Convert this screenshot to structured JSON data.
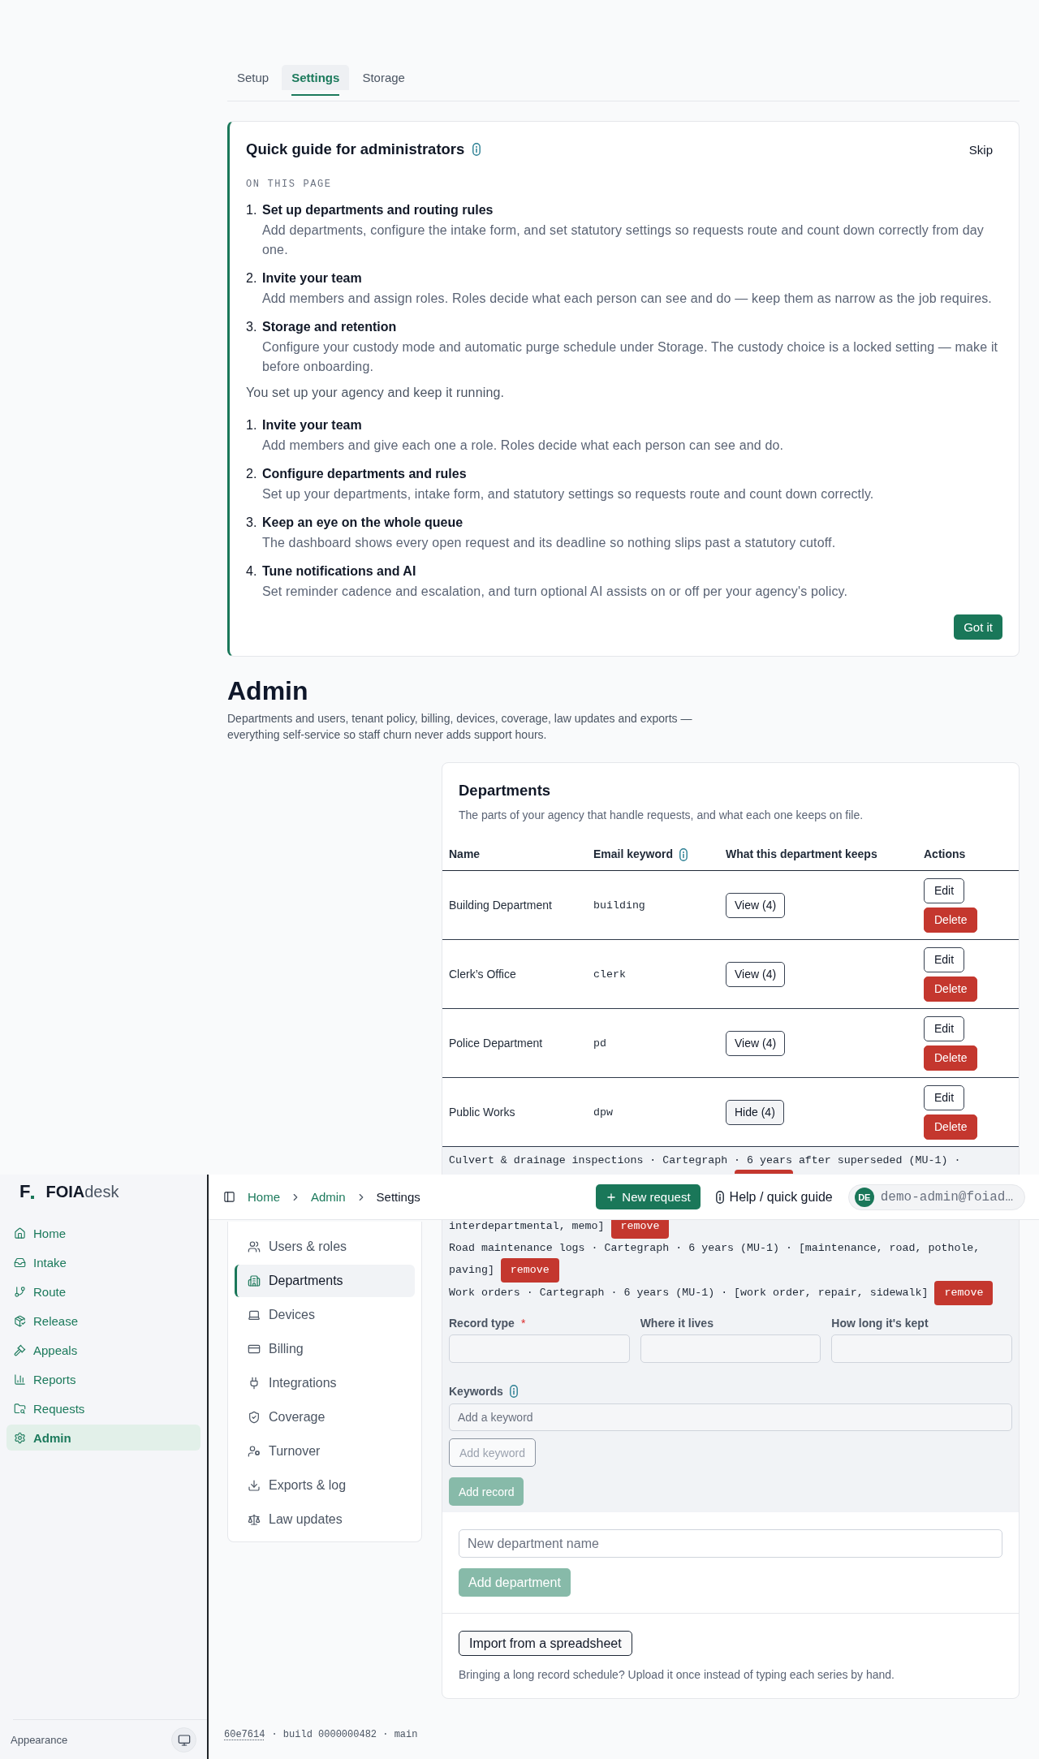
{
  "tabs": [
    {
      "label": "Setup",
      "selected": false
    },
    {
      "label": "Settings",
      "selected": true
    },
    {
      "label": "Storage",
      "selected": false
    }
  ],
  "guide": {
    "title": "Quick guide for administrators",
    "skip": "Skip",
    "section_label": "ON THIS PAGE",
    "steps": [
      {
        "number": "1.",
        "title": "Set up departments and routing rules",
        "text": "Add departments, configure the intake form, and set statutory settings so requests route and count down correctly from day one."
      },
      {
        "number": "2.",
        "title": "Invite your team",
        "text": "Add members and assign roles. Roles decide what each person can see and do — keep them as narrow as the job requires."
      },
      {
        "number": "3.",
        "title": "Storage and retention",
        "text": "Configure your custody mode and automatic purge schedule under Storage. The custody choice is a locked setting — make it before onboarding."
      }
    ],
    "intro": "You set up your agency and keep it running.",
    "tasks": [
      {
        "number": "1.",
        "title": "Invite your team",
        "text": "Add members and give each one a role. Roles decide what each person can see and do."
      },
      {
        "number": "2.",
        "title": "Configure departments and rules",
        "text": "Set up your departments, intake form, and statutory settings so requests route and count down correctly."
      },
      {
        "number": "3.",
        "title": "Keep an eye on the whole queue",
        "text": "The dashboard shows every open request and its deadline so nothing slips past a statutory cutoff."
      },
      {
        "number": "4.",
        "title": "Tune notifications and AI",
        "text": "Set reminder cadence and escalation, and turn optional AI assists on or off per your agency's policy."
      }
    ],
    "done_button": "Got it"
  },
  "admin": {
    "title": "Admin",
    "description": "Departments and users, tenant policy, billing, devices, coverage, law updates and exports — everything self-service so staff churn never adds support hours."
  },
  "settings_nav": [
    {
      "label": "Users & roles",
      "selected": false
    },
    {
      "label": "Departments",
      "selected": true
    },
    {
      "label": "Devices",
      "selected": false
    },
    {
      "label": "Billing",
      "selected": false
    },
    {
      "label": "Integrations",
      "selected": false
    },
    {
      "label": "Coverage",
      "selected": false
    },
    {
      "label": "Turnover",
      "selected": false
    },
    {
      "label": "Exports & log",
      "selected": false
    },
    {
      "label": "Law updates",
      "selected": false
    }
  ],
  "departments": {
    "title": "Departments",
    "subtitle": "The parts of your agency that handle requests, and what each one keeps on file.",
    "columns": [
      {
        "label": "Name",
        "info": false
      },
      {
        "label": "Email keyword",
        "info": true
      },
      {
        "label": "What this department keeps",
        "info": false
      },
      {
        "label": "Actions",
        "info": false
      }
    ],
    "rows": [
      {
        "name": "Building Department",
        "keyword": "building",
        "records_toggle": "View (4)",
        "expanded": false,
        "edit": "Edit",
        "delete": "Delete"
      },
      {
        "name": "Clerk’s Office",
        "keyword": "clerk",
        "records_toggle": "View (4)",
        "expanded": false,
        "edit": "Edit",
        "delete": "Delete"
      },
      {
        "name": "Police Department",
        "keyword": "pd",
        "records_toggle": "View (4)",
        "expanded": false,
        "edit": "Edit",
        "delete": "Delete"
      },
      {
        "name": "Public Works",
        "keyword": "dpw",
        "records_toggle": "Hide (4)",
        "expanded": true,
        "edit": "Edit",
        "delete": "Delete",
        "records": [
          {
            "lines": [
              "Culvert & drainage inspections · Cartegraph · 6 years after superseded (MU-1) ·"
            ],
            "covered_below": true
          },
          {
            "lines": [
              "interdepartmental, memo]"
            ],
            "remove": "remove",
            "covered_below": false
          },
          {
            "lines": [
              "Road maintenance logs · Cartegraph · 6 years (MU-1) · [maintenance, road, pothole,",
              "paving]"
            ],
            "remove": "remove",
            "covered_below": false
          },
          {
            "lines": [
              "Work orders · Cartegraph · 6 years (MU-1) · [work order, repair, sidewalk]"
            ],
            "remove": "remove",
            "covered_below": false
          }
        ],
        "record_form": {
          "fields": [
            {
              "label": "Record type",
              "required_mark": "*"
            },
            {
              "label": "Where it lives"
            },
            {
              "label": "How long it's kept"
            }
          ],
          "keywords_label": "Keywords",
          "keyword_placeholder": "Add a keyword",
          "add_keyword": {
            "label": "Add keyword",
            "disabled": true
          },
          "add_record": {
            "label": "Add record",
            "disabled": true
          }
        }
      }
    ],
    "new_department": {
      "placeholder": "New department name",
      "button": {
        "label": "Add department",
        "disabled": true
      }
    },
    "import": {
      "button": "Import from a spreadsheet",
      "hint": "Bringing a long record schedule? Upload it once instead of typing each series by hand."
    }
  },
  "footer": {
    "commit": "60e7614",
    "details": "· build 0000000482 · main"
  },
  "sidebar": {
    "brand": {
      "mark": "F",
      "name": "**FOIA**desk"
    },
    "items": [
      {
        "label": "Home",
        "selected": false
      },
      {
        "label": "Intake",
        "selected": false
      },
      {
        "label": "Route",
        "selected": false
      },
      {
        "label": "Release",
        "selected": false
      },
      {
        "label": "Appeals",
        "selected": false
      },
      {
        "label": "Reports",
        "selected": false
      },
      {
        "label": "Requests",
        "selected": false
      },
      {
        "label": "Admin",
        "selected": true
      }
    ],
    "appearance": "Appearance"
  },
  "topbar": {
    "breadcrumb": [
      {
        "label": "Home",
        "current": false
      },
      {
        "label": "Admin",
        "current": false
      },
      {
        "label": "Settings",
        "current": true
      }
    ],
    "new_request": "New request",
    "help": "Help / quick guide",
    "user": {
      "initials": "DE",
      "email": "demo-admin@foiad…"
    }
  }
}
